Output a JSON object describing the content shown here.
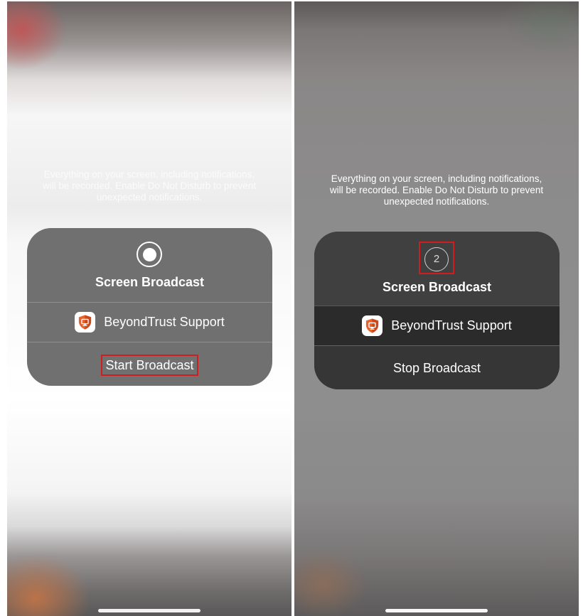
{
  "left_screen": {
    "warning_text": "Everything on your screen, including notifications, will be recorded. Enable Do Not Disturb to prevent unexpected notifications.",
    "card": {
      "status_icon": "record-icon",
      "title": "Screen Broadcast",
      "app_icon": "beyondtrust-shield-icon",
      "app_name": "BeyondTrust Support",
      "action_label": "Start Broadcast"
    }
  },
  "right_screen": {
    "warning_text": "Everything on your screen, including notifications, will be recorded. Enable Do Not Disturb to prevent unexpected notifications.",
    "card": {
      "countdown": "2",
      "title": "Screen Broadcast",
      "app_icon": "beyondtrust-shield-icon",
      "app_name": "BeyondTrust Support",
      "action_label": "Stop Broadcast"
    }
  },
  "colors": {
    "highlight": "#d11d1d",
    "brand_orange": "#e8622a"
  }
}
